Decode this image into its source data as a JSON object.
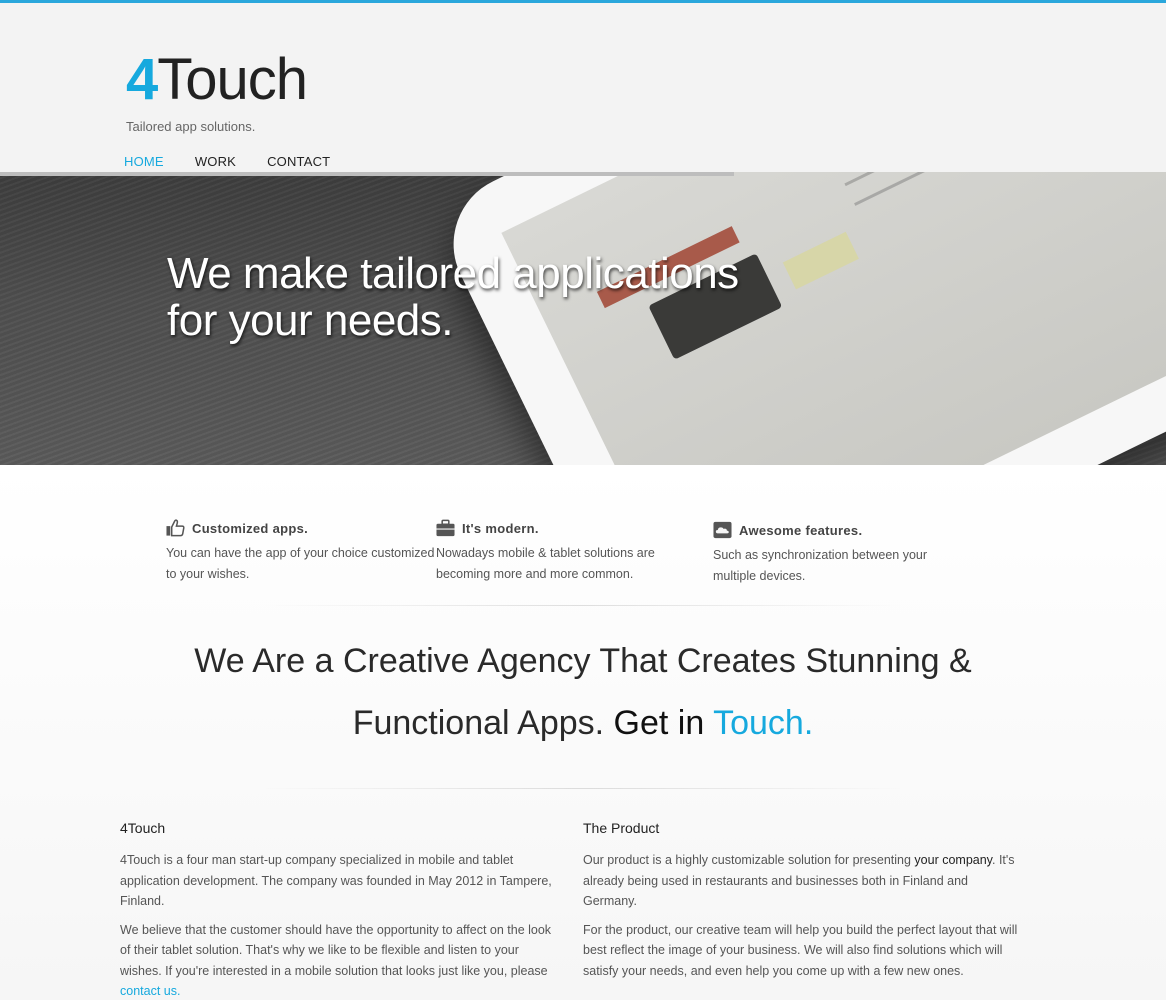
{
  "brand": {
    "logo_num": "4",
    "logo_word": "Touch",
    "tagline": "Tailored app solutions."
  },
  "nav": {
    "items": [
      {
        "label": "HOME",
        "active": true
      },
      {
        "label": "WORK",
        "active": false
      },
      {
        "label": "CONTACT",
        "active": false
      }
    ]
  },
  "hero": {
    "line1": "We make tailored applications",
    "line2": "for your needs."
  },
  "features": [
    {
      "icon": "thumbs-up-icon",
      "title": "Customized apps.",
      "text": "You can have the app of your choice customized to your wishes."
    },
    {
      "icon": "briefcase-icon",
      "title": "It's modern.",
      "text": "Nowadays mobile & tablet solutions are becoming more and more common."
    },
    {
      "icon": "cloud-icon",
      "title": "Awesome features.",
      "text": "Such as synchronization between your multiple devices."
    }
  ],
  "headline": {
    "line1": "We Are a Creative Agency That Creates Stunning &",
    "line2_part1": "Functional Apps. ",
    "line2_part2": "Get in ",
    "line2_accent": "Touch."
  },
  "about": {
    "title": "4Touch",
    "p1": "4Touch is a four man start-up company specialized in mobile and tablet application development. The company was founded in May 2012 in Tampere, Finland.",
    "p2": "We believe that the customer should have the opportunity to affect on the look of their tablet solution. That's why we like to be flexible and listen to your wishes. If you're interested in a mobile solution that looks just like you, please ",
    "p2_link": "contact us."
  },
  "product": {
    "title": "The Product",
    "p1_a": "Our product is a highly customizable solution for presenting ",
    "p1_dark": "your company",
    "p1_b": ". It's already being used in restaurants and businesses both in Finland and Germany.",
    "p2": "For the product, our creative team will help you build the perfect layout that will best reflect the image of your business. We will also find solutions which will satisfy your needs, and even help you come up with a few new ones."
  },
  "colors": {
    "accent": "#16a9de",
    "topbar": "#2aa7dc"
  }
}
